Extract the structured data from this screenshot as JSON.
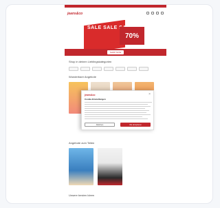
{
  "header": {
    "logo_text": "jeans&co"
  },
  "banner": {
    "sale_text": "SALE SALE SALE",
    "discount_text": "70%",
    "cta_label": "SHOP NOW"
  },
  "sections": {
    "categories_title": "Shop in deinen Lieblingskategorien",
    "trending_title": "Wunderbare Angebote",
    "second_title": "Angebote zum Teilen",
    "third_title": "Unsere besten Ideen"
  },
  "categories": [
    "",
    "",
    "",
    "",
    "",
    "",
    "",
    ""
  ],
  "modal": {
    "logo_text": "jeans&co",
    "title": "Cookie-Einstellungen",
    "close_label": "×",
    "decline_label": "Ablehnen",
    "accept_label": "Alle akzeptieren"
  },
  "colors": {
    "brand": "#c1272d",
    "sale_red": "#d92b2b",
    "card_border": "#e6e9ef"
  }
}
